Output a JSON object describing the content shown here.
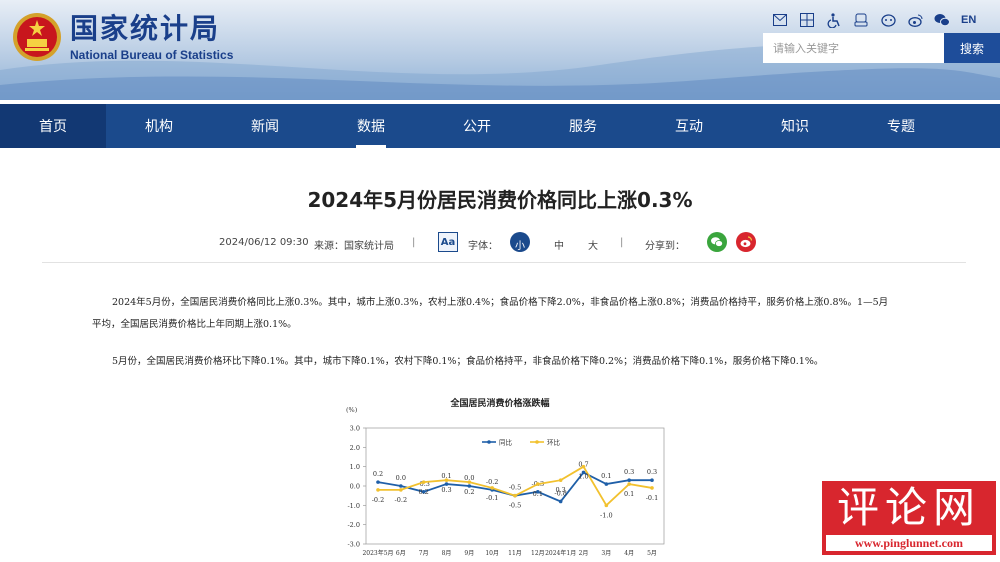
{
  "header": {
    "site_name_cn": "国家统计局",
    "site_name_en": "National Bureau of Statistics",
    "lang_label": "EN",
    "search_placeholder": "请输入关键字",
    "search_button": "搜索",
    "icons": [
      "mail-icon",
      "sitemap-icon",
      "accessibility-icon",
      "elder-mode-icon",
      "mascot-icon",
      "weibo-icon",
      "wechat-icon"
    ]
  },
  "nav": {
    "items": [
      "首页",
      "机构",
      "新闻",
      "数据",
      "公开",
      "服务",
      "互动",
      "知识",
      "专题"
    ],
    "active": "数据"
  },
  "article": {
    "title": "2024年5月份居民消费价格同比上涨0.3%",
    "datetime": "2024/06/12 09:30",
    "source": "来源：国家统计局",
    "font_label": "字体：",
    "font_small": "小",
    "font_medium": "中",
    "font_large": "大",
    "share_label": "分享到：",
    "paragraphs": [
      "2024年5月份，全国居民消费价格同比上涨0.3%。其中，城市上涨0.3%，农村上涨0.4%；食品价格下降2.0%，非食品价格上涨0.8%；消费品价格持平，服务价格上涨0.8%。1—5月平均，全国居民消费价格比上年同期上涨0.1%。",
      "5月份，全国居民消费价格环比下降0.1%。其中，城市下降0.1%，农村下降0.1%；食品价格持平，非食品价格下降0.2%；消费品价格下降0.1%，服务价格下降0.1%。"
    ]
  },
  "chart_data": {
    "type": "line",
    "title": "全国居民消费价格涨跌幅",
    "ylabel": "(%)",
    "ylim": [
      -3.0,
      3.0
    ],
    "yticks": [
      "3.0",
      "2.0",
      "1.0",
      "0.0",
      "-1.0",
      "-2.0",
      "-3.0"
    ],
    "categories": [
      "2023年5月",
      "6月",
      "7月",
      "8月",
      "9月",
      "10月",
      "11月",
      "12月",
      "2024年1月",
      "2月",
      "3月",
      "4月",
      "5月"
    ],
    "x_tick_labels": [
      "2023年5月",
      "6月",
      "7月",
      "8月",
      "9月",
      "10月",
      "11月",
      "12月",
      "2024年1月",
      "2月",
      "3月",
      "4月",
      "5月"
    ],
    "legend": "top",
    "series": [
      {
        "name": "同比",
        "color": "#1f5fa8",
        "values": [
          0.2,
          0.0,
          -0.3,
          0.1,
          0.0,
          -0.2,
          -0.5,
          -0.3,
          -0.8,
          0.7,
          0.1,
          0.3,
          0.3
        ],
        "labels": [
          "0.2",
          "0.0",
          "-0.3",
          "0.1",
          "0.0",
          "-0.2",
          "-0.5",
          "-0.3",
          "-0.8",
          "0.7",
          "0.1",
          "0.3",
          "0.3"
        ]
      },
      {
        "name": "环比",
        "color": "#f2c12e",
        "values": [
          -0.2,
          -0.2,
          0.2,
          0.3,
          0.2,
          -0.1,
          -0.5,
          0.1,
          0.3,
          1.0,
          -1.0,
          0.1,
          -0.1
        ],
        "labels": [
          "-0.2",
          "-0.2",
          "0.2",
          "0.3",
          "0.2",
          "-0.1",
          "-0.5",
          "0.1",
          "0.3",
          "1.0",
          "-1.0",
          "0.1",
          "-0.1"
        ]
      }
    ]
  },
  "watermark": {
    "text_cn": "评论网",
    "url": "www.pinglunnet.com"
  }
}
